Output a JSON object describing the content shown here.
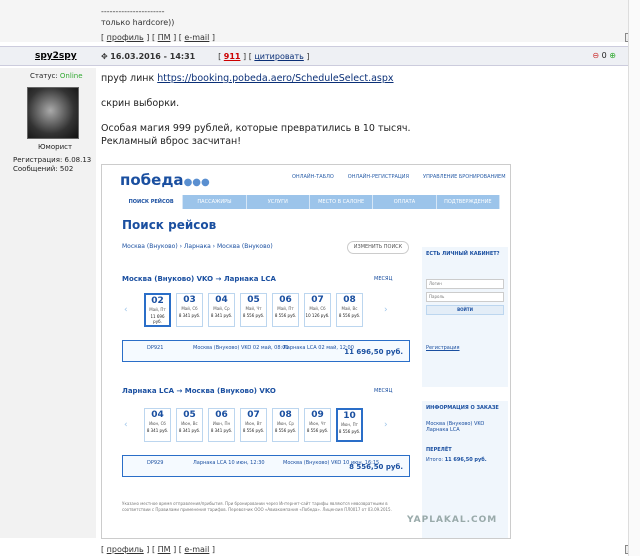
{
  "prev_post": {
    "dashes": "----------------------",
    "text": "только hardcore))"
  },
  "post_links": {
    "profile": "профиль",
    "pm": "ПМ",
    "email": "e-mail"
  },
  "post": {
    "author": "spy2spy",
    "datetime": "16.03.2016 - 14:31",
    "score": "911",
    "quote": "цитировать",
    "status_label": "Статус:",
    "status_value": "Online",
    "rank": "Юморист",
    "reg_label": "Регистрация: 6.08.13",
    "msgs_label": "Сообщений: 502",
    "rating_count": "0",
    "line1_prefix": "пруф линк",
    "link": "https://booking.pobeda.aero/ScheduleSelect.aspx",
    "line2": "скрин выборки.",
    "line3": "Особая магия 999 рублей, которые превратились в 10 тысяч.",
    "line4": "Рекламный вброс засчитан!"
  },
  "shot": {
    "logo": "победа",
    "nav": [
      "ОНЛАЙН-ТАБЛО",
      "ОНЛАЙН-РЕГИСТРАЦИЯ",
      "УПРАВЛЕНИЕ БРОНИРОВАНИЕМ"
    ],
    "steps": [
      "ПОИСК РЕЙСОВ",
      "ПАССАЖИРЫ",
      "УСЛУГИ",
      "МЕСТО В САЛОНЕ",
      "ОПЛАТА",
      "ПОДТВЕРЖДЕНИЕ"
    ],
    "title": "Поиск рейсов",
    "route": "Москва (Внуково) › Ларнака › Москва (Внуково)",
    "change": "ИЗМЕНИТЬ ПОИСК",
    "month": "МЕСЯЦ",
    "leg1": "Москва (Внуково) VKO → Ларнака LCA",
    "leg2": "Ларнака LCA → Москва (Внуково) VKO",
    "dates1": [
      {
        "d": "02",
        "w": "Май, Пт",
        "p": "11 696 руб."
      },
      {
        "d": "03",
        "w": "Май, Сб",
        "p": "8 341 руб."
      },
      {
        "d": "04",
        "w": "Май, Ср",
        "p": "8 341 руб."
      },
      {
        "d": "05",
        "w": "Май, Чт",
        "p": "8 556 руб."
      },
      {
        "d": "06",
        "w": "Май, Пт",
        "p": "8 556 руб."
      },
      {
        "d": "07",
        "w": "Май, Сб",
        "p": "10 126 руб."
      },
      {
        "d": "08",
        "w": "Май, Вс",
        "p": "8 556 руб."
      }
    ],
    "dates2": [
      {
        "d": "04",
        "w": "Июн, Сб",
        "p": "8 341 руб."
      },
      {
        "d": "05",
        "w": "Июн, Вс",
        "p": "8 341 руб."
      },
      {
        "d": "06",
        "w": "Июн, Пн",
        "p": "8 341 руб."
      },
      {
        "d": "07",
        "w": "Июн, Вт",
        "p": "8 556 руб."
      },
      {
        "d": "08",
        "w": "Июн, Ср",
        "p": "8 556 руб."
      },
      {
        "d": "09",
        "w": "Июн, Чт",
        "p": "8 556 руб."
      },
      {
        "d": "10",
        "w": "Июн, Пт",
        "p": "8 556 руб."
      }
    ],
    "flight1": {
      "no": "DP921",
      "from": "Москва (Внуково) VKO 02 май, 08:00",
      "to": "Ларнака LCA 02 май, 12:00",
      "price": "11 696,50 руб."
    },
    "flight2": {
      "no": "DP929",
      "from": "Ларнака LCA 10 июн, 12:30",
      "to": "Москва (Внуково) VKO 10 июн, 16:15",
      "price": "8 556,50 руб."
    },
    "panel1": {
      "title": "ЕСТЬ ЛИЧНЫЙ КАБИНЕТ?",
      "login": "Логин",
      "password": "Пароль",
      "btn": "ВОЙТИ",
      "reg": "Регистрация"
    },
    "panel2": {
      "title": "ИНФОРМАЦИЯ О ЗАКАЗЕ",
      "out": "Москва (Внуково) VKO",
      "in": "Ларнака LCA",
      "flight": "ПЕРЕЛЁТ",
      "total_label": "Итого:",
      "total": "11 696,50 руб."
    },
    "fine": "Указано местное время отправления/прибытия. При бронировании через Интернет-сайт тарифы являются невозвратными в соответствии с Правилами применения тарифов. Перевозчик ООО «Авиакомпания «Победа». Лицензия ПЛ0017 от 03.09.2015.",
    "watermark": "YAPLAKAL.COM"
  }
}
